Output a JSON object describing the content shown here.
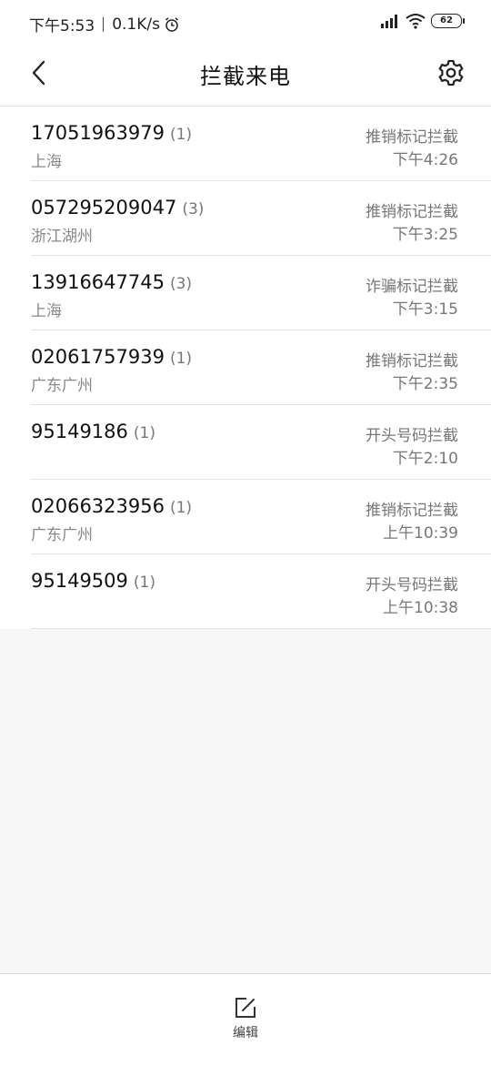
{
  "status": {
    "time": "下午5:53",
    "speed": "0.1K/s",
    "battery": "62"
  },
  "header": {
    "title": "拦截来电"
  },
  "calls": [
    {
      "number": "17051963979",
      "count": "(1)",
      "location": "上海",
      "reason": "推销标记拦截",
      "time": "下午4:26"
    },
    {
      "number": "057295209047",
      "count": "(3)",
      "location": "浙江湖州",
      "reason": "推销标记拦截",
      "time": "下午3:25"
    },
    {
      "number": "13916647745",
      "count": "(3)",
      "location": "上海",
      "reason": "诈骗标记拦截",
      "time": "下午3:15"
    },
    {
      "number": "02061757939",
      "count": "(1)",
      "location": "广东广州",
      "reason": "推销标记拦截",
      "time": "下午2:35"
    },
    {
      "number": "95149186",
      "count": "(1)",
      "location": "",
      "reason": "开头号码拦截",
      "time": "下午2:10"
    },
    {
      "number": "02066323956",
      "count": "(1)",
      "location": "广东广州",
      "reason": "推销标记拦截",
      "time": "上午10:39"
    },
    {
      "number": "95149509",
      "count": "(1)",
      "location": "",
      "reason": "开头号码拦截",
      "time": "上午10:38"
    }
  ],
  "footer": {
    "edit_label": "编辑"
  },
  "icons": {
    "back": "chevron-left-icon",
    "settings": "gear-icon",
    "edit": "edit-icon",
    "alarm": "alarm-clock-icon",
    "signal": "signal-icon",
    "wifi": "wifi-icon",
    "battery": "battery-icon"
  }
}
